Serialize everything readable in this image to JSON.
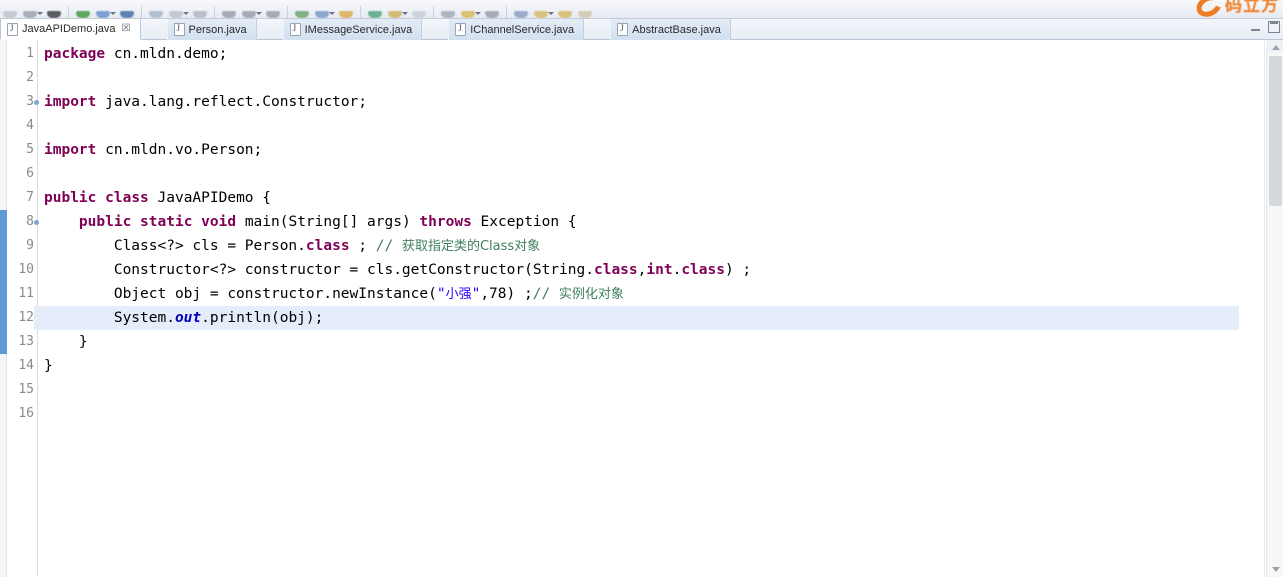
{
  "window": {
    "app": "Eclipse IDE",
    "watermark_text": "码立方"
  },
  "toolbar": {
    "icons": [
      {
        "name": "save-icon",
        "color": "#b8bec8"
      },
      {
        "name": "print-icon",
        "color": "#8f9aa8"
      },
      {
        "name": "debug-icon",
        "color": "#2b2b2b"
      },
      {
        "name": "run-icon",
        "color": "#2f8f2f"
      },
      {
        "name": "external-tools-icon",
        "color": "#5b86c4"
      },
      {
        "name": "coverage-icon",
        "color": "#2f5f9f"
      },
      {
        "name": "new-java-project-icon",
        "color": "#9fb0c4"
      },
      {
        "name": "new-class-icon",
        "color": "#b6bcc6"
      },
      {
        "name": "search-icon",
        "color": "#a8b0bc"
      },
      {
        "name": "next-annotation-icon",
        "color": "#8d96a4"
      },
      {
        "name": "prev-annotation-icon",
        "color": "#8d96a4"
      },
      {
        "name": "last-edit-icon",
        "color": "#8d96a4"
      },
      {
        "name": "back-icon",
        "color": "#5f9e5f"
      },
      {
        "name": "forward-icon",
        "color": "#6d8fc0"
      },
      {
        "name": "pin-icon",
        "color": "#d8a63a"
      },
      {
        "name": "perspective-icon",
        "color": "#3f9e6f"
      },
      {
        "name": "open-type-icon",
        "color": "#c9ad52"
      },
      {
        "name": "open-task-icon",
        "color": "#c4cad4"
      },
      {
        "name": "terminal-icon",
        "color": "#9aa3b0"
      },
      {
        "name": "tag-icon",
        "color": "#d8b24a"
      },
      {
        "name": "filter-icon",
        "color": "#8d96a4"
      },
      {
        "name": "step-into-icon",
        "color": "#7d97bb"
      },
      {
        "name": "bookmark-icon",
        "color": "#d5b257"
      },
      {
        "name": "bookmark2-icon",
        "color": "#d5b257"
      },
      {
        "name": "bookmark3-icon",
        "color": "#ccc3a6"
      }
    ]
  },
  "tabs": {
    "items": [
      {
        "label": "JavaAPIDemo.java",
        "active": true,
        "closable": true,
        "close_glyph": "☒"
      },
      {
        "label": "Person.java",
        "active": false,
        "closable": false,
        "close_glyph": ""
      },
      {
        "label": "IMessageService.java",
        "active": false,
        "closable": false,
        "close_glyph": ""
      },
      {
        "label": "IChannelService.java",
        "active": false,
        "closable": false,
        "close_glyph": ""
      },
      {
        "label": "AbstractBase.java",
        "active": false,
        "closable": false,
        "close_glyph": ""
      }
    ],
    "minimize_label": "Minimize",
    "maximize_label": "Maximize"
  },
  "editor": {
    "current_line": 12,
    "block_marker_color": "#5e9ad4",
    "current_line_color": "#e5edfb",
    "line_numbers": [
      "1",
      "2",
      "3",
      "4",
      "5",
      "6",
      "7",
      "8",
      "9",
      "10",
      "11",
      "12",
      "13",
      "14",
      "15",
      "16"
    ],
    "fold_lines": [
      3,
      8
    ],
    "lines": [
      {
        "n": "1",
        "tokens": [
          {
            "t": "package",
            "c": "kw"
          },
          {
            "t": " cn.mldn.demo;",
            "c": "plain"
          }
        ]
      },
      {
        "n": "2",
        "tokens": []
      },
      {
        "n": "3",
        "tokens": [
          {
            "t": "import",
            "c": "kw"
          },
          {
            "t": " java.lang.reflect.Constructor;",
            "c": "plain"
          }
        ]
      },
      {
        "n": "4",
        "tokens": []
      },
      {
        "n": "5",
        "tokens": [
          {
            "t": "import",
            "c": "kw"
          },
          {
            "t": " cn.mldn.vo.Person;",
            "c": "plain"
          }
        ]
      },
      {
        "n": "6",
        "tokens": []
      },
      {
        "n": "7",
        "tokens": [
          {
            "t": "public",
            "c": "kw"
          },
          {
            "t": " ",
            "c": "plain"
          },
          {
            "t": "class",
            "c": "kw"
          },
          {
            "t": " JavaAPIDemo {",
            "c": "plain"
          }
        ]
      },
      {
        "n": "8",
        "tokens": [
          {
            "t": "    ",
            "c": "plain"
          },
          {
            "t": "public",
            "c": "kw"
          },
          {
            "t": " ",
            "c": "plain"
          },
          {
            "t": "static",
            "c": "kw"
          },
          {
            "t": " ",
            "c": "plain"
          },
          {
            "t": "void",
            "c": "kw"
          },
          {
            "t": " main(String[] args) ",
            "c": "plain"
          },
          {
            "t": "throws",
            "c": "kw"
          },
          {
            "t": " Exception {",
            "c": "plain"
          }
        ]
      },
      {
        "n": "9",
        "tokens": [
          {
            "t": "        Class<?> cls = Person.",
            "c": "plain"
          },
          {
            "t": "class",
            "c": "kw"
          },
          {
            "t": " ; ",
            "c": "plain"
          },
          {
            "t": "// ",
            "c": "cmt"
          },
          {
            "t": "获取指定类的Class对象",
            "c": "cmt-cn"
          }
        ]
      },
      {
        "n": "10",
        "tokens": [
          {
            "t": "        Constructor<?> constructor = cls.getConstructor(String.",
            "c": "plain"
          },
          {
            "t": "class",
            "c": "kw"
          },
          {
            "t": ",",
            "c": "plain"
          },
          {
            "t": "int",
            "c": "kw"
          },
          {
            "t": ".",
            "c": "plain"
          },
          {
            "t": "class",
            "c": "kw"
          },
          {
            "t": ") ;",
            "c": "plain"
          }
        ]
      },
      {
        "n": "11",
        "tokens": [
          {
            "t": "        Object obj = constructor.newInstance(",
            "c": "plain"
          },
          {
            "t": "\"",
            "c": "str"
          },
          {
            "t": "小强",
            "c": "str-cn"
          },
          {
            "t": "\"",
            "c": "str"
          },
          {
            "t": ",78) ;",
            "c": "plain"
          },
          {
            "t": "// ",
            "c": "cmt"
          },
          {
            "t": "实例化对象",
            "c": "cmt-cn"
          }
        ]
      },
      {
        "n": "12",
        "tokens": [
          {
            "t": "        System.",
            "c": "plain"
          },
          {
            "t": "out",
            "c": "fld"
          },
          {
            "t": ".println(obj);",
            "c": "plain"
          }
        ]
      },
      {
        "n": "13",
        "tokens": [
          {
            "t": "    }",
            "c": "plain"
          }
        ]
      },
      {
        "n": "14",
        "tokens": [
          {
            "t": "}",
            "c": "plain"
          }
        ]
      },
      {
        "n": "15",
        "tokens": []
      },
      {
        "n": "16",
        "tokens": []
      }
    ]
  },
  "scrollbar": {
    "up_label": "Scroll up",
    "down_label": "Scroll down",
    "thumb_label": "Scroll thumb"
  }
}
